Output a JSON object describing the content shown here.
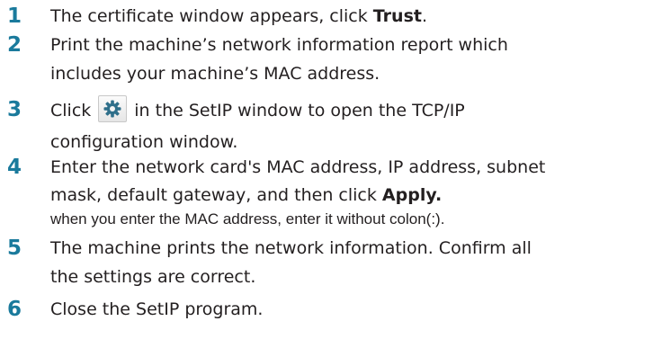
{
  "steps": [
    {
      "number": "1",
      "line1_before": "The certificate window appears, click ",
      "line1_bold": "Trust",
      "line1_after": "."
    },
    {
      "number": "2",
      "line1": "Print the machine’s network information report which",
      "line2": "includes your machine’s MAC address."
    },
    {
      "number": "3",
      "line1_before": "Click",
      "icon": "gear-icon",
      "line1_after": "in the SetIP window to open the TCP/IP",
      "line2": "configuration window."
    },
    {
      "number": "4",
      "line1": "Enter the network card's MAC address, IP address, subnet",
      "line2_before": "mask, default gateway, and then click ",
      "line2_bold": "Apply.",
      "note": "when you enter the MAC address, enter it without colon(:)."
    },
    {
      "number": "5",
      "line1": "The machine prints the network information. Confirm all",
      "line2": "the settings are correct."
    },
    {
      "number": "6",
      "line1": "Close the SetIP program."
    }
  ],
  "colors": {
    "step_number": "#1a7a9c",
    "text": "#231f20"
  }
}
